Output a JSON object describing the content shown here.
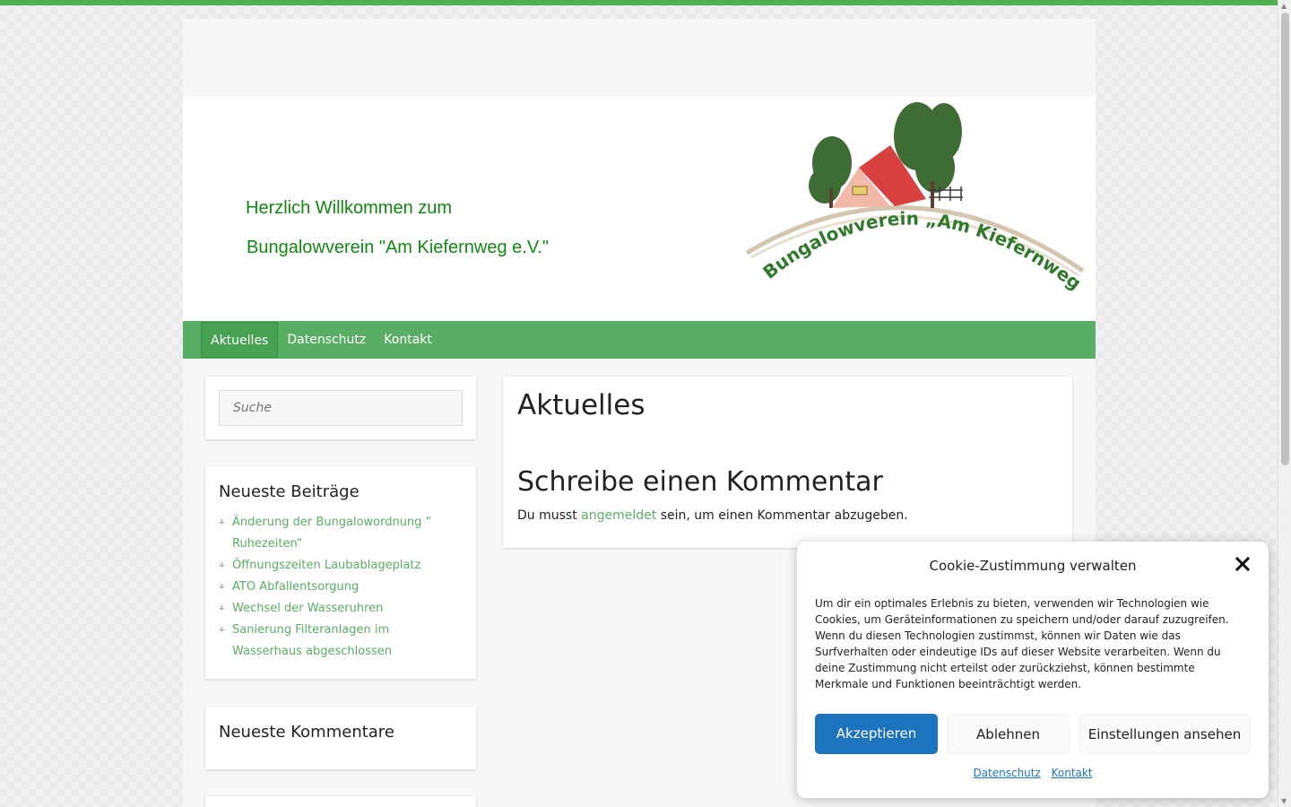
{
  "header": {
    "welcome_line1": "Herzlich Willkommen zum",
    "welcome_line2": "Bungalowverein \"Am Kiefernweg e.V.\"",
    "logo_text": "Bungalowverein „Am Kiefernweg e.V.“"
  },
  "nav": {
    "items": [
      {
        "label": "Aktuelles",
        "active": true
      },
      {
        "label": "Datenschutz",
        "active": false
      },
      {
        "label": "Kontakt",
        "active": false
      }
    ]
  },
  "sidebar": {
    "search_placeholder": "Suche",
    "recent_posts_title": "Neueste Beiträge",
    "recent_posts": [
      "Änderung der Bungalowordnung “ Ruhezeiten“",
      "Öffnungszeiten Laubablageplatz",
      "ATO Abfallentsorgung",
      "Wechsel der Wasseruhren",
      "Sanierung Filteranlagen im Wasserhaus abgeschlossen"
    ],
    "recent_comments_title": "Neueste Kommentare"
  },
  "main": {
    "page_title": "Aktuelles",
    "comment_title": "Schreibe einen Kommentar",
    "login_prefix": "Du musst",
    "login_link": "angemeldet",
    "login_suffix": "sein, um einen Kommentar abzugeben."
  },
  "cookie": {
    "title": "Cookie-Zustimmung verwalten",
    "text": "Um dir ein optimales Erlebnis zu bieten, verwenden wir Technologien wie Cookies, um Geräteinformationen zu speichern und/oder darauf zuzugreifen. Wenn du diesen Technologien zustimmst, können wir Daten wie das Surfverhalten oder eindeutige IDs auf dieser Website verarbeiten. Wenn du deine Zustimmung nicht erteilst oder zurückziehst, können bestimmte Merkmale und Funktionen beeinträchtigt werden.",
    "accept_label": "Akzeptieren",
    "deny_label": "Ablehnen",
    "settings_label": "Einstellungen ansehen",
    "link_privacy": "Datenschutz",
    "link_contact": "Kontakt"
  },
  "colors": {
    "accent_green": "#5aad64",
    "accept_blue": "#1e73be",
    "welcome_green": "#118811"
  }
}
